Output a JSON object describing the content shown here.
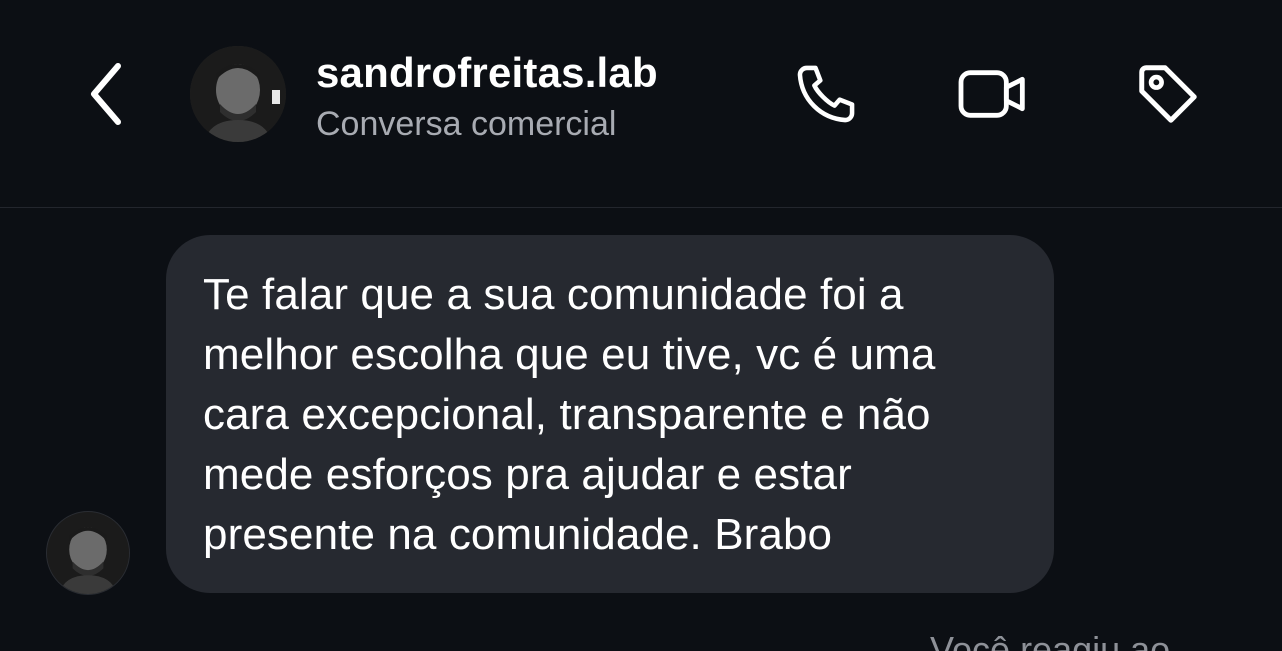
{
  "header": {
    "back_icon": "chevron-left-icon",
    "avatar": "profile-photo",
    "username": "sandrofreitas.lab",
    "subtitle": "Conversa comercial",
    "actions": [
      {
        "icon": "phone-icon"
      },
      {
        "icon": "video-camera-icon"
      },
      {
        "icon": "tag-icon"
      }
    ]
  },
  "thread": {
    "message": {
      "text": "Te falar que a sua comunidade foi a\nmelhor escolha que eu tive, vc é uma\ncara excepcional, transparente e não\nmede esforços pra ajudar e estar\npresente na comunidade. Brabo"
    },
    "footer_partial": "Você reagiu ao"
  },
  "colors": {
    "background": "#0c0f14",
    "bubble": "#262930",
    "subtitle": "#a8abb2",
    "divider": "#23262d",
    "icon": "#ffffff"
  }
}
